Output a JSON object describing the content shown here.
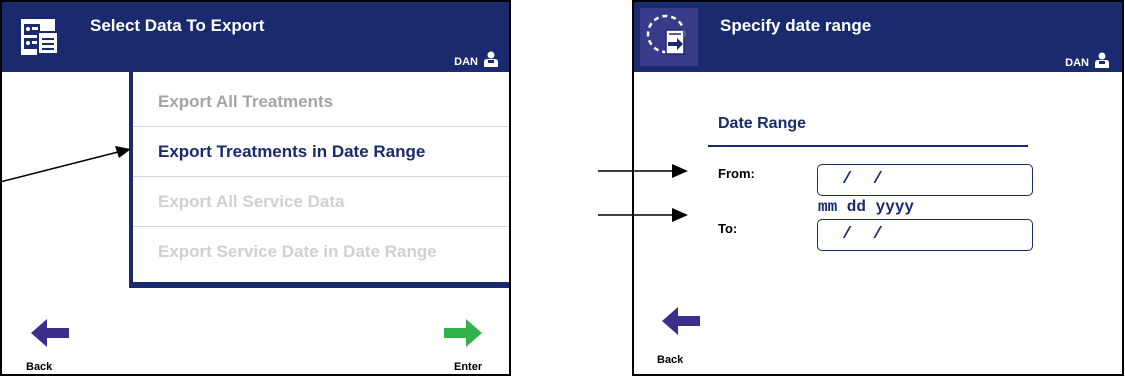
{
  "screen1": {
    "title": "Select Data To Export",
    "user": "DAN",
    "menu_items": [
      {
        "label": "Export All Treatments",
        "state": "normal"
      },
      {
        "label": "Export Treatments in Date Range",
        "state": "selected"
      },
      {
        "label": "Export All Service Data",
        "state": "disabled"
      },
      {
        "label": "Export Service Date in Date Range",
        "state": "disabled"
      }
    ],
    "back_label": "Back",
    "enter_label": "Enter"
  },
  "screen2": {
    "title": "Specify date range",
    "user": "DAN",
    "section_title": "Date Range",
    "from_label": "From:",
    "from_value": "/  /",
    "to_label": "To:",
    "to_value": "/  /",
    "date_format": "mm dd yyyy",
    "back_label": "Back"
  },
  "colors": {
    "header_blue": "#1a2a6e",
    "enter_green": "#2fb34a",
    "back_purple": "#3a2f8a"
  },
  "icons": [
    "export-data-icon",
    "user-icon",
    "date-range-icon",
    "back-arrow-icon",
    "enter-arrow-icon",
    "pointer-arrow-icon"
  ]
}
